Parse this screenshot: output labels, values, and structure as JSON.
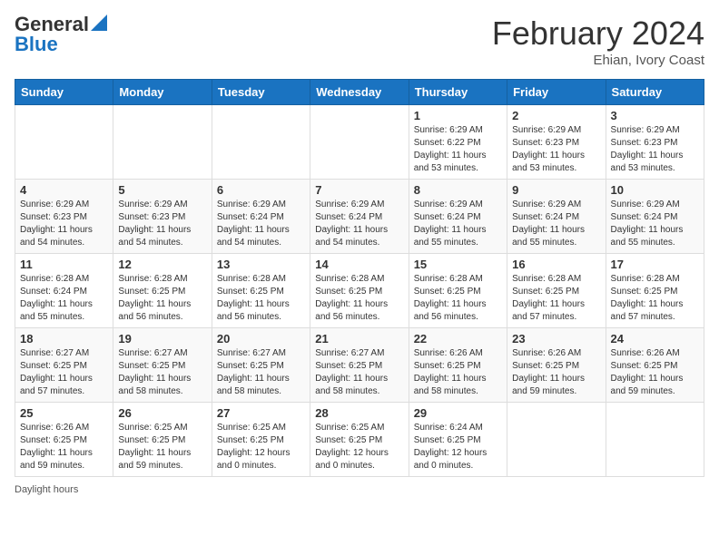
{
  "logo": {
    "line1": "General",
    "line2": "Blue"
  },
  "title": "February 2024",
  "subtitle": "Ehian, Ivory Coast",
  "days": [
    "Sunday",
    "Monday",
    "Tuesday",
    "Wednesday",
    "Thursday",
    "Friday",
    "Saturday"
  ],
  "weeks": [
    [
      {
        "day": "",
        "info": ""
      },
      {
        "day": "",
        "info": ""
      },
      {
        "day": "",
        "info": ""
      },
      {
        "day": "",
        "info": ""
      },
      {
        "day": "1",
        "info": "Sunrise: 6:29 AM\nSunset: 6:22 PM\nDaylight: 11 hours\nand 53 minutes."
      },
      {
        "day": "2",
        "info": "Sunrise: 6:29 AM\nSunset: 6:23 PM\nDaylight: 11 hours\nand 53 minutes."
      },
      {
        "day": "3",
        "info": "Sunrise: 6:29 AM\nSunset: 6:23 PM\nDaylight: 11 hours\nand 53 minutes."
      }
    ],
    [
      {
        "day": "4",
        "info": "Sunrise: 6:29 AM\nSunset: 6:23 PM\nDaylight: 11 hours\nand 54 minutes."
      },
      {
        "day": "5",
        "info": "Sunrise: 6:29 AM\nSunset: 6:23 PM\nDaylight: 11 hours\nand 54 minutes."
      },
      {
        "day": "6",
        "info": "Sunrise: 6:29 AM\nSunset: 6:24 PM\nDaylight: 11 hours\nand 54 minutes."
      },
      {
        "day": "7",
        "info": "Sunrise: 6:29 AM\nSunset: 6:24 PM\nDaylight: 11 hours\nand 54 minutes."
      },
      {
        "day": "8",
        "info": "Sunrise: 6:29 AM\nSunset: 6:24 PM\nDaylight: 11 hours\nand 55 minutes."
      },
      {
        "day": "9",
        "info": "Sunrise: 6:29 AM\nSunset: 6:24 PM\nDaylight: 11 hours\nand 55 minutes."
      },
      {
        "day": "10",
        "info": "Sunrise: 6:29 AM\nSunset: 6:24 PM\nDaylight: 11 hours\nand 55 minutes."
      }
    ],
    [
      {
        "day": "11",
        "info": "Sunrise: 6:28 AM\nSunset: 6:24 PM\nDaylight: 11 hours\nand 55 minutes."
      },
      {
        "day": "12",
        "info": "Sunrise: 6:28 AM\nSunset: 6:25 PM\nDaylight: 11 hours\nand 56 minutes."
      },
      {
        "day": "13",
        "info": "Sunrise: 6:28 AM\nSunset: 6:25 PM\nDaylight: 11 hours\nand 56 minutes."
      },
      {
        "day": "14",
        "info": "Sunrise: 6:28 AM\nSunset: 6:25 PM\nDaylight: 11 hours\nand 56 minutes."
      },
      {
        "day": "15",
        "info": "Sunrise: 6:28 AM\nSunset: 6:25 PM\nDaylight: 11 hours\nand 56 minutes."
      },
      {
        "day": "16",
        "info": "Sunrise: 6:28 AM\nSunset: 6:25 PM\nDaylight: 11 hours\nand 57 minutes."
      },
      {
        "day": "17",
        "info": "Sunrise: 6:28 AM\nSunset: 6:25 PM\nDaylight: 11 hours\nand 57 minutes."
      }
    ],
    [
      {
        "day": "18",
        "info": "Sunrise: 6:27 AM\nSunset: 6:25 PM\nDaylight: 11 hours\nand 57 minutes."
      },
      {
        "day": "19",
        "info": "Sunrise: 6:27 AM\nSunset: 6:25 PM\nDaylight: 11 hours\nand 58 minutes."
      },
      {
        "day": "20",
        "info": "Sunrise: 6:27 AM\nSunset: 6:25 PM\nDaylight: 11 hours\nand 58 minutes."
      },
      {
        "day": "21",
        "info": "Sunrise: 6:27 AM\nSunset: 6:25 PM\nDaylight: 11 hours\nand 58 minutes."
      },
      {
        "day": "22",
        "info": "Sunrise: 6:26 AM\nSunset: 6:25 PM\nDaylight: 11 hours\nand 58 minutes."
      },
      {
        "day": "23",
        "info": "Sunrise: 6:26 AM\nSunset: 6:25 PM\nDaylight: 11 hours\nand 59 minutes."
      },
      {
        "day": "24",
        "info": "Sunrise: 6:26 AM\nSunset: 6:25 PM\nDaylight: 11 hours\nand 59 minutes."
      }
    ],
    [
      {
        "day": "25",
        "info": "Sunrise: 6:26 AM\nSunset: 6:25 PM\nDaylight: 11 hours\nand 59 minutes."
      },
      {
        "day": "26",
        "info": "Sunrise: 6:25 AM\nSunset: 6:25 PM\nDaylight: 11 hours\nand 59 minutes."
      },
      {
        "day": "27",
        "info": "Sunrise: 6:25 AM\nSunset: 6:25 PM\nDaylight: 12 hours\nand 0 minutes."
      },
      {
        "day": "28",
        "info": "Sunrise: 6:25 AM\nSunset: 6:25 PM\nDaylight: 12 hours\nand 0 minutes."
      },
      {
        "day": "29",
        "info": "Sunrise: 6:24 AM\nSunset: 6:25 PM\nDaylight: 12 hours\nand 0 minutes."
      },
      {
        "day": "",
        "info": ""
      },
      {
        "day": "",
        "info": ""
      }
    ]
  ],
  "footer": "Daylight hours"
}
